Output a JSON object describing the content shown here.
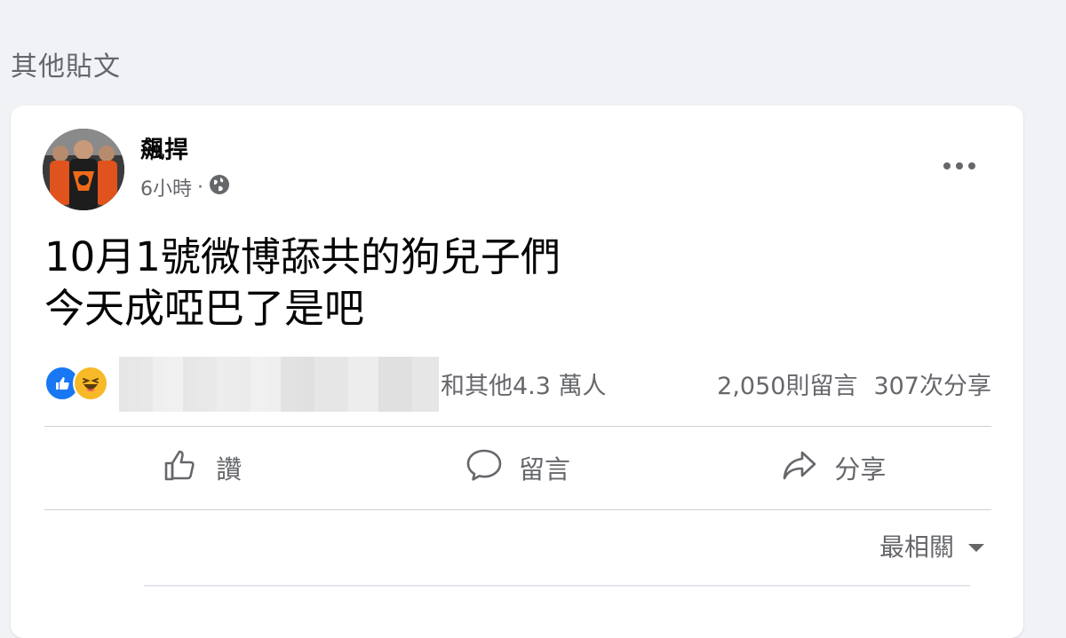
{
  "section": {
    "title": "其他貼文"
  },
  "post": {
    "author": {
      "name": "飆捍"
    },
    "meta": {
      "time": "6小時",
      "separator": "·",
      "audience_icon": "globe-icon"
    },
    "text_lines": [
      "10月1號微博舔共的狗兒子們",
      "今天成啞巴了是吧"
    ],
    "reactions": {
      "icons": [
        "like-icon",
        "haha-icon"
      ],
      "others_text": "和其他4.3 萬人",
      "comments_count": "2,050則留言",
      "shares_count": "307次分享"
    },
    "actions": {
      "like_label": "讚",
      "comment_label": "留言",
      "share_label": "分享"
    },
    "sort": {
      "label": "最相關"
    }
  },
  "colors": {
    "page_bg": "#f0f2f5",
    "like_blue": "#1877f2",
    "haha_yellow": "#f7b928",
    "secondary_text": "#65676b"
  }
}
